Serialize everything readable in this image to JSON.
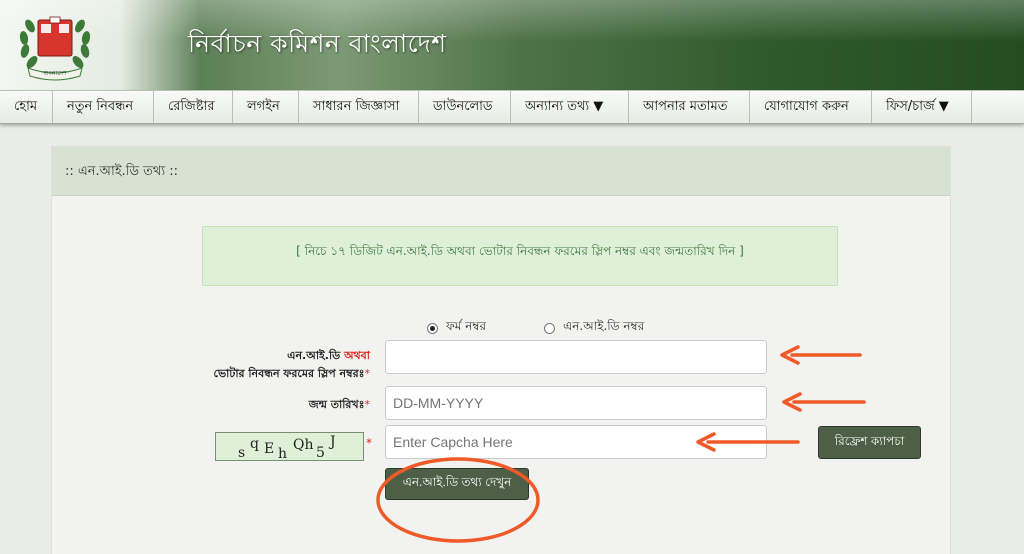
{
  "header": {
    "title": "নির্বাচন কমিশন বাংলাদেশ",
    "logo_text": "বাংলাদেশ"
  },
  "nav": {
    "items": [
      {
        "label": "হোম"
      },
      {
        "label": "নতুন নিবন্ধন"
      },
      {
        "label": "রেজিষ্টার"
      },
      {
        "label": "লগইন"
      },
      {
        "label": "সাধারন জিজ্ঞাসা"
      },
      {
        "label": "ডাউনলোড"
      },
      {
        "label": "অন্যান্য তথ্য ▼"
      },
      {
        "label": "আপনার মতামত"
      },
      {
        "label": "যোগাযোগ করুন"
      },
      {
        "label": "ফিস/চার্জ ▼"
      }
    ]
  },
  "panel": {
    "title": ":: এন.আই.ডি তথ্য ::",
    "notice": "[ নিচে ১৭ ডিজিট এন.আই.ডি অথবা ভোটার নিবন্ধন ফরমের স্লিপ নম্বর এবং জন্মতারিখ দিন ]"
  },
  "form": {
    "radio_form_number": "ফর্ম নম্বর",
    "radio_nid_number": "এন.আই.ডি নম্বর",
    "nid_label_part1": "এন.আই.ডি",
    "nid_label_or": "অথবা",
    "nid_label_line2": "ভোটার নিবন্ধন ফরমের স্লিপ নম্বরঃ",
    "required_mark": "*",
    "nid_value": "",
    "dob_label": "জন্ম তারিখঃ",
    "dob_placeholder": "DD-MM-YYYY",
    "captcha_placeholder": "Enter Capcha Here",
    "captcha_chars": [
      "s",
      "q",
      "E",
      "h",
      "Qh",
      "5",
      "J"
    ],
    "refresh_button": "রিফ্রেশ ক্যাপচা",
    "submit_button": "এন.আই.ডি তথ্য দেখুন"
  },
  "colors": {
    "annotation": "#f05a28",
    "button": "#4e5f48",
    "notice_text": "#3c763d",
    "header_dark": "#234d21"
  }
}
